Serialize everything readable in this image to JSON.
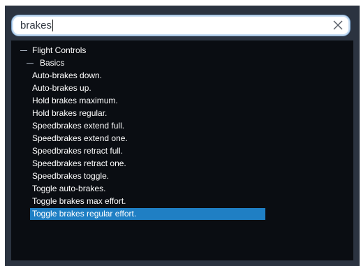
{
  "search": {
    "value": "brakes",
    "clear_icon": "close-icon"
  },
  "tree": {
    "group": {
      "label": "Flight Controls",
      "expanded": true,
      "subgroup": {
        "label": "Basics",
        "expanded": true,
        "items": [
          "Auto-brakes down.",
          "Auto-brakes up.",
          "Hold brakes maximum.",
          "Hold brakes regular.",
          "Speedbrakes extend full.",
          "Speedbrakes extend one.",
          "Speedbrakes retract full.",
          "Speedbrakes retract one.",
          "Speedbrakes toggle.",
          "Toggle auto-brakes.",
          "Toggle brakes max effort.",
          "Toggle brakes regular effort."
        ],
        "selected_index": 11
      }
    }
  },
  "colors": {
    "window_bg": "#2b3340",
    "tree_bg": "#0a0d12",
    "selection": "#1f7fc4",
    "search_border": "#c6dcf2"
  }
}
